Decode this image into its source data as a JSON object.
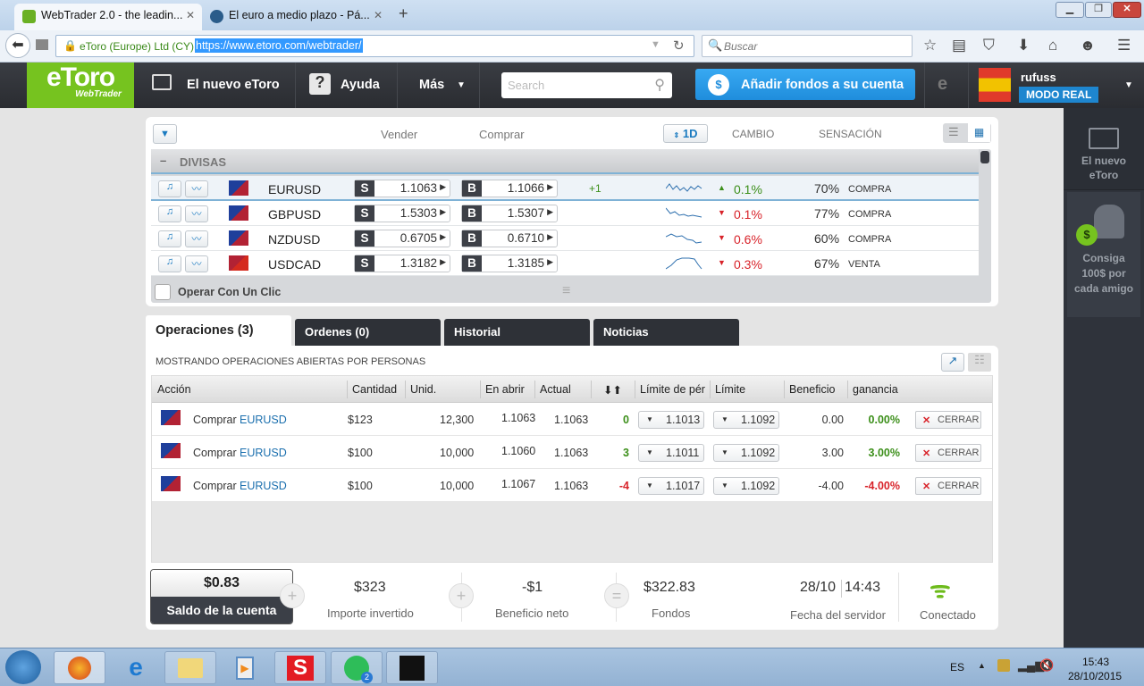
{
  "browser": {
    "tabs": [
      {
        "label": "WebTrader 2.0 - the leadin...",
        "active": true
      },
      {
        "label": "El euro a medio plazo - Pá...",
        "active": false
      }
    ],
    "new_tab": "+",
    "site_identity": "eToro (Europe) Ltd (CY)",
    "url": "https://www.etoro.com/webtrader/",
    "search_placeholder": "Buscar"
  },
  "header": {
    "logo": "eToro",
    "logo_sub": "WebTrader",
    "nav": {
      "new_etoro": "El nuevo eToro",
      "help": "Ayuda",
      "more": "Más"
    },
    "search_placeholder": "Search",
    "add_funds": "Añadir fondos a su cuenta",
    "username": "rufuss",
    "mode": "MODO REAL",
    "accent": "#2b9be8",
    "brand": "#76c31f"
  },
  "sidebar": {
    "new_etoro": "El nuevo eToro",
    "referral": "Consiga 100$ por cada amigo",
    "referral_badge": "$"
  },
  "markets": {
    "col_sell": "Vender",
    "col_buy": "Comprar",
    "period": "1D",
    "col_change": "CAMBIO",
    "col_sentiment": "SENSACIÓN",
    "group": "DIVISAS",
    "group_toggle": "–",
    "rows": [
      {
        "symbol": "EURUSD",
        "sell": "1.1063",
        "buy": "1.1066",
        "spread": "+1",
        "change": "0.1%",
        "dir": "up",
        "sentiment": "70%",
        "sentiment_label": "COMPRA"
      },
      {
        "symbol": "GBPUSD",
        "sell": "1.5303",
        "buy": "1.5307",
        "spread": "",
        "change": "0.1%",
        "dir": "down",
        "sentiment": "77%",
        "sentiment_label": "COMPRA"
      },
      {
        "symbol": "NZDUSD",
        "sell": "0.6705",
        "buy": "0.6710",
        "spread": "",
        "change": "0.6%",
        "dir": "down",
        "sentiment": "60%",
        "sentiment_label": "COMPRA"
      },
      {
        "symbol": "USDCAD",
        "sell": "1.3182",
        "buy": "1.3185",
        "spread": "",
        "change": "0.3%",
        "dir": "down",
        "sentiment": "67%",
        "sentiment_label": "VENTA"
      }
    ],
    "sell_letter": "S",
    "buy_letter": "B",
    "one_click": "Operar Con Un Clic"
  },
  "tabs": [
    {
      "label": "Operaciones (3)",
      "active": true
    },
    {
      "label": "Ordenes (0)"
    },
    {
      "label": "Historial"
    },
    {
      "label": "Noticias"
    }
  ],
  "operations": {
    "caption": "MOSTRANDO OPERACIONES ABIERTAS POR PERSONAS",
    "headers": [
      "Acción",
      "Cantidad",
      "Unid.",
      "En abrir",
      "Actual",
      "",
      "Límite de pér",
      "Límite",
      "Beneficio",
      "ganancia"
    ],
    "action_verb": "Comprar",
    "close_label": "CERRAR",
    "rows": [
      {
        "symbol": "EURUSD",
        "amount": "$123",
        "units": "12,300",
        "open": "1.1063",
        "current": "1.1063",
        "pips": "0",
        "stop": "1.1013",
        "limit": "1.1092",
        "profit": "0.00",
        "gain": "0.00%",
        "sign": "pos"
      },
      {
        "symbol": "EURUSD",
        "amount": "$100",
        "units": "10,000",
        "open": "1.1060",
        "current": "1.1063",
        "pips": "3",
        "stop": "1.1011",
        "limit": "1.1092",
        "profit": "3.00",
        "gain": "3.00%",
        "sign": "pos"
      },
      {
        "symbol": "EURUSD",
        "amount": "$100",
        "units": "10,000",
        "open": "1.1067",
        "current": "1.1063",
        "pips": "-4",
        "stop": "1.1017",
        "limit": "1.1092",
        "profit": "-4.00",
        "gain": "-4.00%",
        "sign": "neg"
      }
    ]
  },
  "summary": {
    "balance": "$0.83",
    "balance_label": "Saldo de la cuenta",
    "invested": "$323",
    "invested_label": "Importe invertido",
    "net_profit": "-$1",
    "net_profit_label": "Beneficio neto",
    "funds": "$322.83",
    "funds_label": "Fondos",
    "server_date": "28/10",
    "server_time": "14:43",
    "server_label": "Fecha del servidor",
    "status": "Conectado"
  },
  "taskbar": {
    "lang": "ES",
    "time": "15:43",
    "date": "28/10/2015",
    "spotify_badge": "2"
  }
}
